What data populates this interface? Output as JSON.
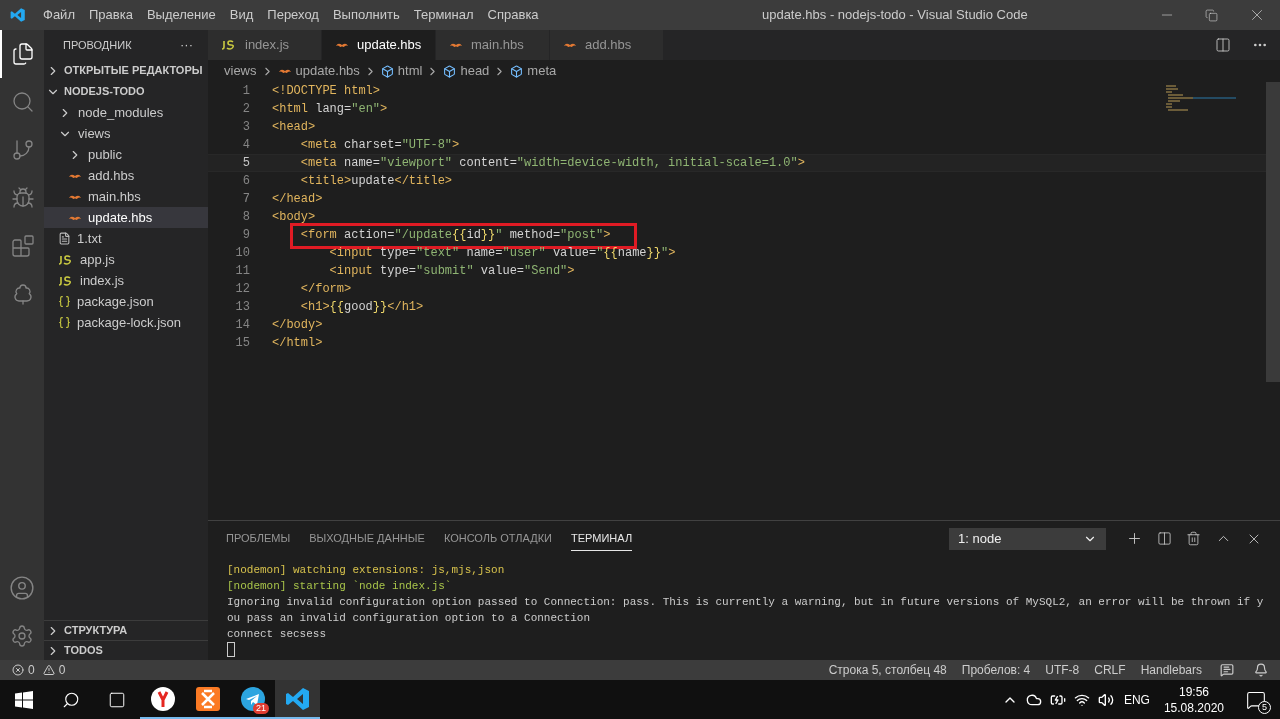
{
  "window": {
    "title": "update.hbs - nodejs-todo - Visual Studio Code"
  },
  "menu": [
    "Файл",
    "Правка",
    "Выделение",
    "Вид",
    "Переход",
    "Выполнить",
    "Терминал",
    "Справка"
  ],
  "activity_bar": [
    {
      "kind": "files",
      "selected": true
    },
    {
      "kind": "search",
      "selected": false
    },
    {
      "kind": "git",
      "selected": false
    },
    {
      "kind": "debug",
      "selected": false
    },
    {
      "kind": "extensions",
      "selected": false
    },
    {
      "kind": "tree",
      "selected": false
    }
  ],
  "sidebar": {
    "title": "ПРОВОДНИК",
    "more": "···",
    "open_editors": {
      "label": "ОТКРЫТЫЕ РЕДАКТОРЫ",
      "expanded": false
    },
    "project": {
      "label": "NODEJS-TODO",
      "expanded": true
    },
    "items": [
      {
        "kind": "folder",
        "label": "node_modules",
        "expanded": false,
        "selected": false
      },
      {
        "kind": "folder",
        "label": "views",
        "expanded": true,
        "selected": false,
        "children": [
          {
            "kind": "folder",
            "label": "public",
            "expanded": false,
            "selected": false
          },
          {
            "kind": "hbs",
            "label": "add.hbs",
            "selected": false
          },
          {
            "kind": "hbs",
            "label": "main.hbs",
            "selected": false
          },
          {
            "kind": "hbs",
            "label": "update.hbs",
            "selected": true
          }
        ]
      },
      {
        "kind": "txt",
        "label": "1.txt",
        "selected": false
      },
      {
        "kind": "js",
        "label": "app.js",
        "selected": false
      },
      {
        "kind": "js",
        "label": "index.js",
        "selected": false
      },
      {
        "kind": "json",
        "label": "package.json",
        "selected": false
      },
      {
        "kind": "json",
        "label": "package-lock.json",
        "selected": false
      }
    ],
    "sections": [
      {
        "label": "СТРУКТУРА",
        "expanded": false
      },
      {
        "label": "TODOS",
        "expanded": false
      }
    ]
  },
  "tabs": [
    {
      "kind": "js",
      "label": "index.js",
      "selected": false
    },
    {
      "kind": "hbs",
      "label": "update.hbs",
      "selected": true
    },
    {
      "kind": "hbs",
      "label": "main.hbs",
      "selected": false
    },
    {
      "kind": "hbs",
      "label": "add.hbs",
      "selected": false
    }
  ],
  "breadcrumb": [
    {
      "kind": "folder",
      "label": "views"
    },
    {
      "kind": "hbs",
      "label": "update.hbs"
    },
    {
      "kind": "element",
      "label": "html"
    },
    {
      "kind": "element",
      "label": "head"
    },
    {
      "kind": "element",
      "label": "meta"
    }
  ],
  "code": [
    {
      "number": "1",
      "current": false,
      "highlighted": false,
      "tokens": [
        {
          "kind": "tag",
          "text": "<!DOCTYPE html>"
        }
      ]
    },
    {
      "number": "2",
      "current": false,
      "highlighted": false,
      "tokens": [
        {
          "kind": "tag",
          "text": "<html "
        },
        {
          "kind": "attr",
          "text": "lang="
        },
        {
          "kind": "str",
          "text": "\"en\""
        },
        {
          "kind": "tag",
          "text": ">"
        }
      ]
    },
    {
      "number": "3",
      "current": false,
      "highlighted": false,
      "tokens": [
        {
          "kind": "tag",
          "text": "<head>"
        }
      ]
    },
    {
      "number": "4",
      "current": false,
      "highlighted": false,
      "tokens": [
        {
          "kind": "tag",
          "text": "    <meta "
        },
        {
          "kind": "attr",
          "text": "charset="
        },
        {
          "kind": "str",
          "text": "\"UTF-8\""
        },
        {
          "kind": "tag",
          "text": ">"
        }
      ]
    },
    {
      "number": "5",
      "current": true,
      "highlighted": false,
      "tokens": [
        {
          "kind": "tag",
          "text": "    <meta "
        },
        {
          "kind": "attr",
          "text": "name="
        },
        {
          "kind": "str",
          "text": "\"viewport\""
        },
        {
          "kind": "attr",
          "text": " content="
        },
        {
          "kind": "str",
          "text": "\"width=device-width, initial-scale=1.0\""
        },
        {
          "kind": "tag",
          "text": ">"
        }
      ]
    },
    {
      "number": "6",
      "current": false,
      "highlighted": false,
      "tokens": [
        {
          "kind": "tag",
          "text": "    <title>"
        },
        {
          "kind": "text",
          "text": "update"
        },
        {
          "kind": "tag",
          "text": "</title>"
        }
      ]
    },
    {
      "number": "7",
      "current": false,
      "highlighted": false,
      "tokens": [
        {
          "kind": "tag",
          "text": "</head>"
        }
      ]
    },
    {
      "number": "8",
      "current": false,
      "highlighted": false,
      "tokens": [
        {
          "kind": "tag",
          "text": "<body>"
        }
      ]
    },
    {
      "number": "9",
      "current": false,
      "highlighted": true,
      "tokens": [
        {
          "kind": "tag",
          "text": "    <form "
        },
        {
          "kind": "attr",
          "text": "action="
        },
        {
          "kind": "str",
          "text": "\"/update"
        },
        {
          "kind": "brace",
          "text": "{{"
        },
        {
          "kind": "text",
          "text": "id"
        },
        {
          "kind": "brace",
          "text": "}}"
        },
        {
          "kind": "str",
          "text": "\""
        },
        {
          "kind": "attr",
          "text": " method="
        },
        {
          "kind": "str",
          "text": "\"post\""
        },
        {
          "kind": "tag",
          "text": ">"
        }
      ]
    },
    {
      "number": "10",
      "current": false,
      "highlighted": false,
      "tokens": [
        {
          "kind": "tag",
          "text": "        <input "
        },
        {
          "kind": "attr",
          "text": "type="
        },
        {
          "kind": "str",
          "text": "\"text\""
        },
        {
          "kind": "attr",
          "text": " name="
        },
        {
          "kind": "str",
          "text": "\"user\""
        },
        {
          "kind": "attr",
          "text": " value="
        },
        {
          "kind": "str",
          "text": "\""
        },
        {
          "kind": "brace",
          "text": "{{"
        },
        {
          "kind": "text",
          "text": "name"
        },
        {
          "kind": "brace",
          "text": "}}"
        },
        {
          "kind": "str",
          "text": "\""
        },
        {
          "kind": "tag",
          "text": ">"
        }
      ]
    },
    {
      "number": "11",
      "current": false,
      "highlighted": false,
      "tokens": [
        {
          "kind": "tag",
          "text": "        <input "
        },
        {
          "kind": "attr",
          "text": "type="
        },
        {
          "kind": "str",
          "text": "\"submit\""
        },
        {
          "kind": "attr",
          "text": " value="
        },
        {
          "kind": "str",
          "text": "\"Send\""
        },
        {
          "kind": "tag",
          "text": ">"
        }
      ]
    },
    {
      "number": "12",
      "current": false,
      "highlighted": false,
      "tokens": [
        {
          "kind": "tag",
          "text": "    </form>"
        }
      ]
    },
    {
      "number": "13",
      "current": false,
      "highlighted": false,
      "tokens": [
        {
          "kind": "tag",
          "text": "    <h1>"
        },
        {
          "kind": "brace",
          "text": "{{"
        },
        {
          "kind": "text",
          "text": "good"
        },
        {
          "kind": "brace",
          "text": "}}"
        },
        {
          "kind": "tag",
          "text": "</h1>"
        }
      ]
    },
    {
      "number": "14",
      "current": false,
      "highlighted": false,
      "tokens": [
        {
          "kind": "tag",
          "text": "</body>"
        }
      ]
    },
    {
      "number": "15",
      "current": false,
      "highlighted": false,
      "tokens": [
        {
          "kind": "tag",
          "text": "</html>"
        }
      ]
    }
  ],
  "panel": {
    "tabs": [
      {
        "label": "ПРОБЛЕМЫ",
        "selected": false
      },
      {
        "label": "ВЫХОДНЫЕ ДАННЫЕ",
        "selected": false
      },
      {
        "label": "КОНСОЛЬ ОТЛАДКИ",
        "selected": false
      },
      {
        "label": "ТЕРМИНАЛ",
        "selected": true
      }
    ],
    "terminal_select": "1: node",
    "terminal": [
      {
        "text": "[nodemon] watching extensions: js,mjs,json",
        "color": "#d7c24c"
      },
      {
        "text": "[nodemon] starting `node index.js`",
        "color": "#a8c44a"
      },
      {
        "text": "Ignoring invalid configuration option passed to Connection: pass. This is currently a warning, but in future versions of MySQL2, an error will be thrown if y",
        "color": "#cccccc"
      },
      {
        "text": "ou pass an invalid configuration option to a Connection",
        "color": "#cccccc"
      },
      {
        "text": "connect secsess",
        "color": "#cccccc"
      }
    ]
  },
  "status_bar": {
    "errors": "0",
    "warnings": "0",
    "items": [
      "Строка 5, столбец 48",
      "Пробелов: 4",
      "UTF-8",
      "CRLF",
      "Handlebars"
    ]
  },
  "taskbar": {
    "apps": [
      {
        "kind": "yandex",
        "selected": false
      },
      {
        "kind": "xampp",
        "selected": false
      },
      {
        "kind": "telegram",
        "selected": false,
        "badge": "21"
      },
      {
        "kind": "vscode",
        "selected": true
      }
    ],
    "language": "ENG",
    "time": "19:56",
    "date": "15.08.2020",
    "notifications": "5"
  }
}
